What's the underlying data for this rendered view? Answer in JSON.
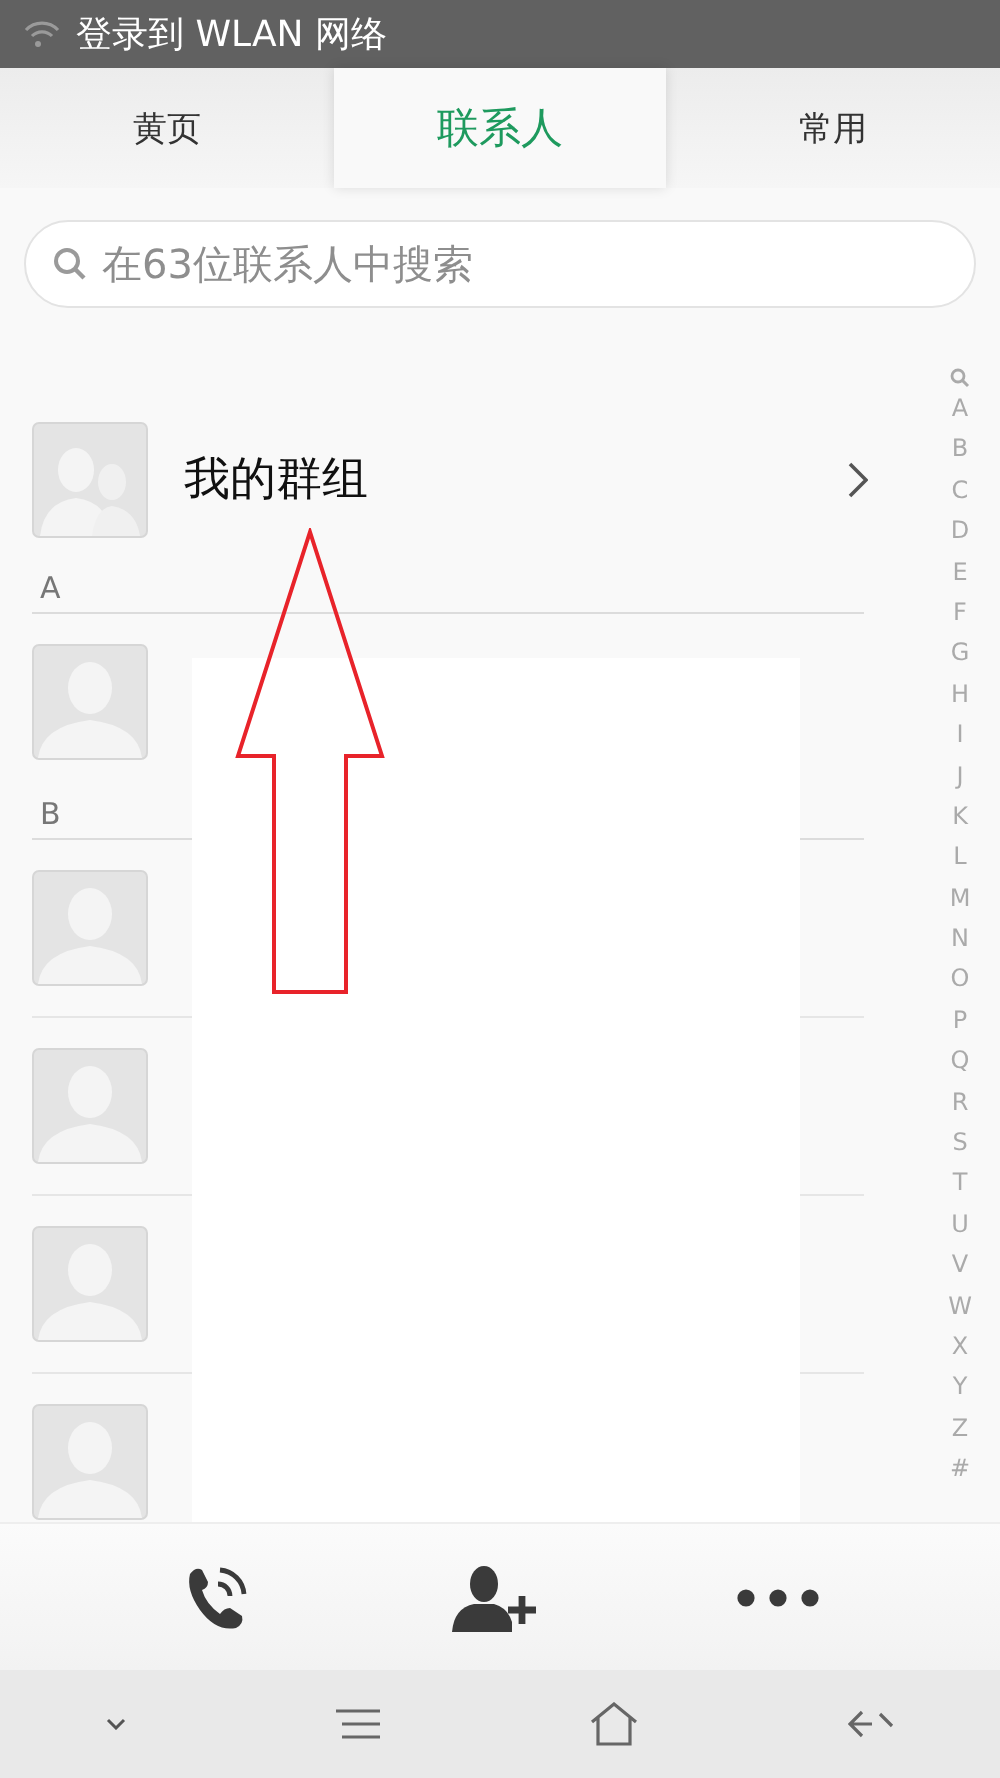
{
  "status_bar": {
    "text": "登录到 WLAN 网络"
  },
  "tabs": [
    {
      "label": "黄页",
      "selected": false
    },
    {
      "label": "联系人",
      "selected": true
    },
    {
      "label": "常用",
      "selected": false
    }
  ],
  "search": {
    "placeholder": "在63位联系人中搜索"
  },
  "group_row": {
    "label": "我的群组"
  },
  "sections": [
    {
      "header": "A",
      "contacts": [
        {
          "kind": "contact"
        }
      ]
    },
    {
      "header": "B",
      "contacts": [
        {
          "kind": "contact"
        },
        {
          "kind": "contact"
        },
        {
          "kind": "contact"
        },
        {
          "kind": "contact"
        }
      ]
    }
  ],
  "index": [
    "A",
    "B",
    "C",
    "D",
    "E",
    "F",
    "G",
    "H",
    "I",
    "J",
    "K",
    "L",
    "M",
    "N",
    "O",
    "P",
    "Q",
    "R",
    "S",
    "T",
    "U",
    "V",
    "W",
    "X",
    "Y",
    "Z",
    "#"
  ]
}
